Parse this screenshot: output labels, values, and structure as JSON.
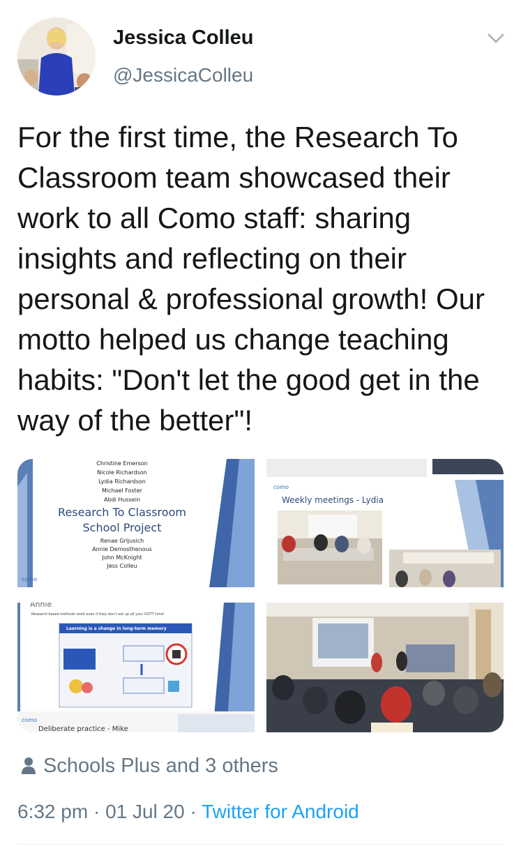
{
  "author": {
    "name": "Jessica Colleu",
    "handle": "@JessicaColleu"
  },
  "tweet": {
    "text": "For the first time, the Research To Classroom team showcased their work to all Como staff: sharing insights and reflecting on their personal & professional growth! Our motto helped us change teaching habits: \"Don't let the good get in the way of the better\"!"
  },
  "media": {
    "slide1": {
      "names_top": [
        "Christine Emerson",
        "Nicole Richardson",
        "Lydia Richardson",
        "Michael Foster",
        "Abdi Hussein"
      ],
      "title_line1": "Research To Classroom",
      "title_line2": "School Project",
      "names_bottom": [
        "Renae Grljusich",
        "Annie Demosthenous",
        "John McKnight",
        "Jess Colleu"
      ],
      "logo": "como"
    },
    "slide2": {
      "logo": "como",
      "title": "Weekly meetings - Lydia"
    },
    "slide3": {
      "header": "Annie",
      "subtitle": "Research based methods work even if they don't eat up all your DOTT time!",
      "box_title": "Learning is a change in long-term memory",
      "logo": "como",
      "footer": "Deliberate practice - Mike"
    }
  },
  "social_context": {
    "icon": "person-icon",
    "text": "Schools Plus and 3 others"
  },
  "meta": {
    "time": "6:32 pm",
    "date": "01 Jul 20",
    "source": "Twitter for Android"
  },
  "colors": {
    "text": "#14171a",
    "secondary": "#657786",
    "link": "#1da1f2"
  }
}
